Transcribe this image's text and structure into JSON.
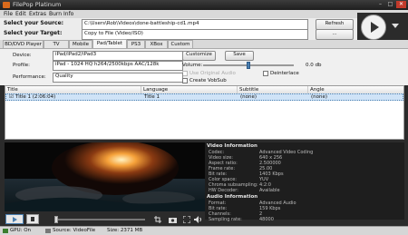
{
  "app": {
    "title": "FilePop Platinum"
  },
  "menu": [
    "File",
    "Edit",
    "Extras",
    "Burn",
    "Info"
  ],
  "source": {
    "label": "Select your Source:",
    "value": "C:\\Users\\Rob\\Videos\\done-battleship-cd1.mp4",
    "refresh_label": "Refresh"
  },
  "target": {
    "label": "Select your Target:",
    "value": "Copy to File (Video/ISO)",
    "browse_label": "..."
  },
  "tabs": [
    "BD/DVD Player",
    "TV",
    "Mobile",
    "Pad/Tablet",
    "PS3",
    "XBox",
    "Custom"
  ],
  "selected_tab": "Pad/Tablet",
  "settings": {
    "device_label": "Device:",
    "device_value": "iPad/iPad2/iPad3",
    "customize_label": "Customize",
    "save_label": "Save",
    "profile_label": "Profile:",
    "profile_value": "iPad - 1024 HQ h264/2500kbps AAC/128k",
    "volume_label": "Volume:",
    "volume_value": "0.0 db",
    "volume_level_percent": 50,
    "use_original_audio_label": "Use Original Audio",
    "deinterlace_label": "Deinterlace",
    "create_vobsub_label": "Create VobSub",
    "performance_label": "Performance:",
    "performance_value": "Quality"
  },
  "grid": {
    "headers": [
      "Title",
      "Language",
      "Subtitle",
      "Angle"
    ],
    "rows": [
      {
        "title": "Title 1 (2:06:04)",
        "language": "Title 1",
        "subtitle": "(none)",
        "angle": "(none)"
      }
    ]
  },
  "video_info": {
    "heading": "Video Information",
    "rows": [
      [
        "Codec:",
        "Advanced Video Coding"
      ],
      [
        "Video size:",
        "640 x 256"
      ],
      [
        "Aspect ratio:",
        "2.500000"
      ],
      [
        "Frame rate:",
        "25.00"
      ],
      [
        "Bit rate:",
        "1403 Kbps"
      ],
      [
        "Color space:",
        "YUV"
      ],
      [
        "Chroma subsampling:",
        "4:2:0"
      ],
      [
        "HW Decoder:",
        "Available"
      ]
    ]
  },
  "audio_info": {
    "heading": "Audio Information",
    "rows": [
      [
        "Format:",
        "Advanced Audio"
      ],
      [
        "Bit rate:",
        "159 Kbps"
      ],
      [
        "Channels:",
        "2"
      ],
      [
        "Sampling rate:",
        "48000"
      ]
    ]
  },
  "status": {
    "gpu": "GPU: On",
    "source": "Source: VideoFile",
    "size": "Size: 2371 MB"
  },
  "colors": {
    "accent_orange": "#d96a1c",
    "selection_blue": "#cfe3f7",
    "dark_bg": "#2b2b2b"
  },
  "icons": [
    "app-icon",
    "minimize-icon",
    "maximize-icon",
    "close-icon",
    "play-icon",
    "dropdown-arrow-icon",
    "stop-icon",
    "crop-icon",
    "snapshot-icon",
    "fullscreen-icon",
    "speaker-icon",
    "gpu-icon",
    "source-icon"
  ]
}
